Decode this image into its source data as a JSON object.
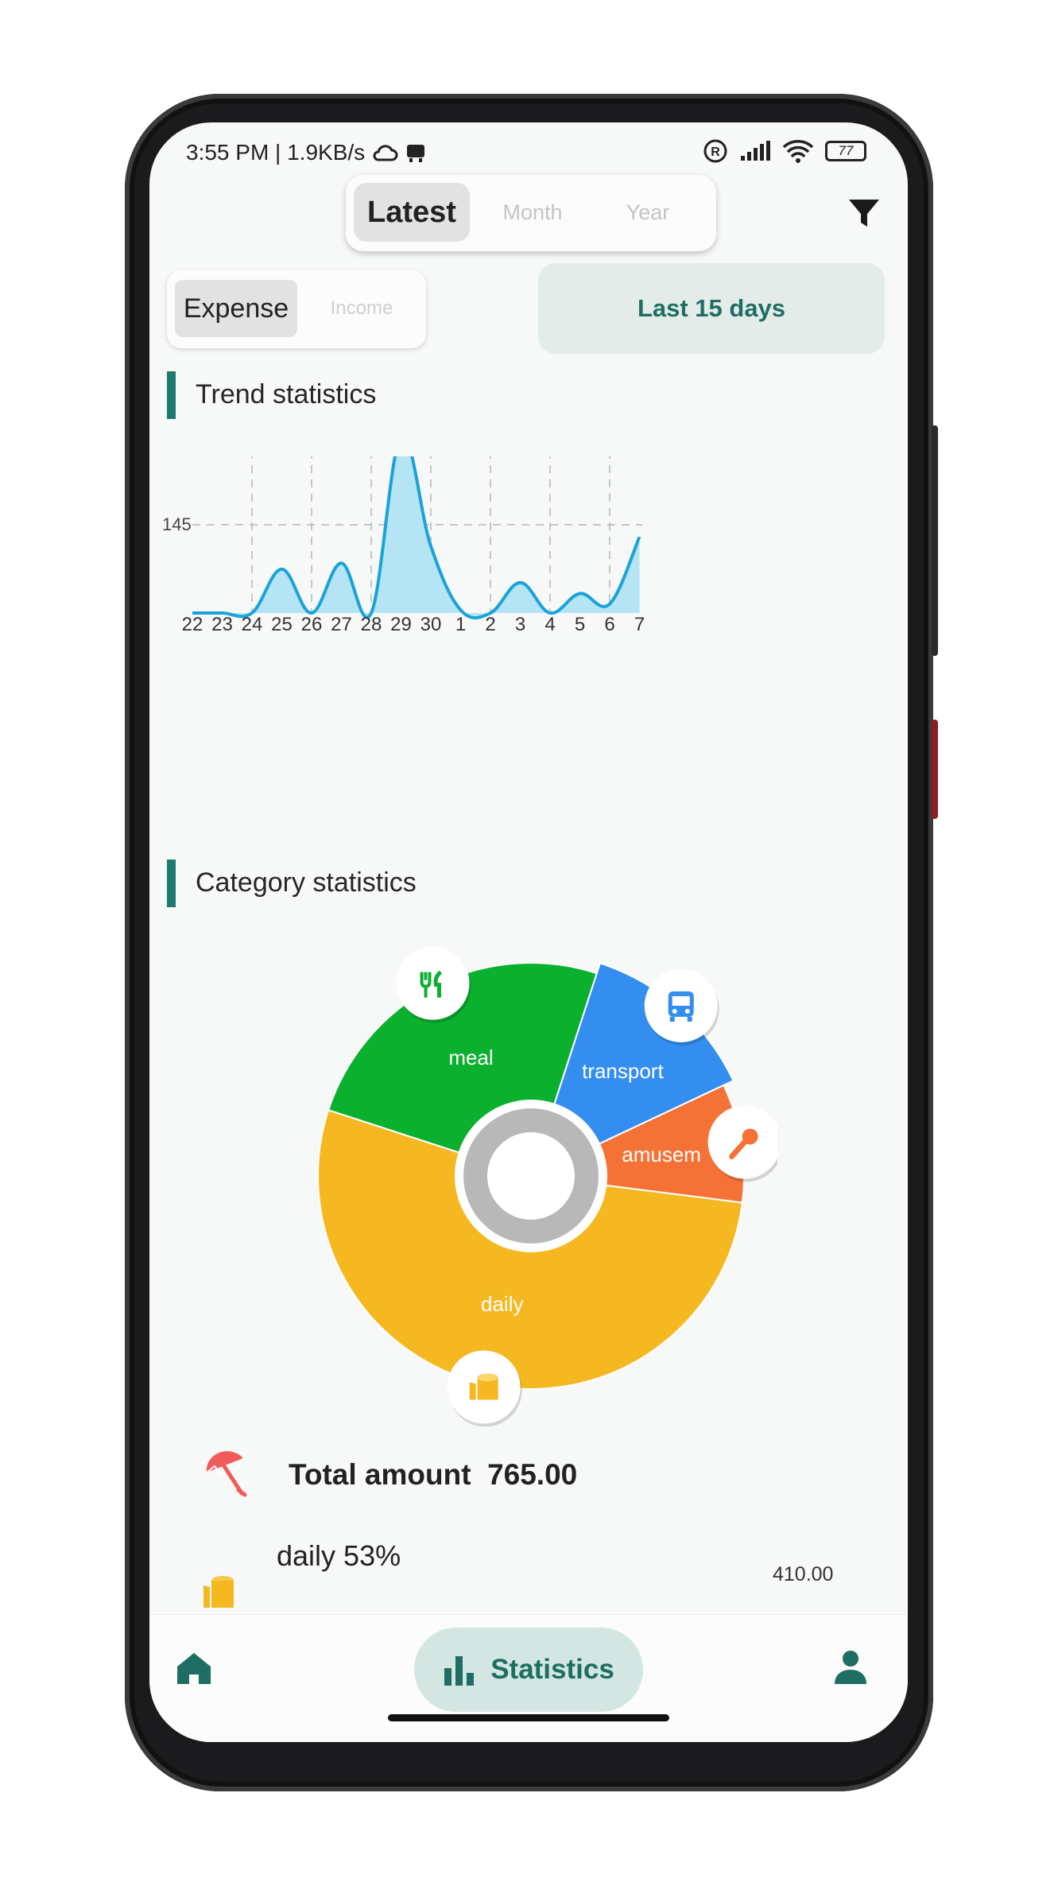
{
  "status_bar": {
    "time_speed": "3:55 PM | 1.9KB/s",
    "battery": "77"
  },
  "period_tabs": [
    {
      "label": "Latest",
      "selected": true
    },
    {
      "label": "Month",
      "selected": false
    },
    {
      "label": "Year",
      "selected": false
    }
  ],
  "type_tabs": [
    {
      "label": "Expense",
      "selected": true
    },
    {
      "label": "Income",
      "selected": false
    }
  ],
  "range_button": "Last 15 days",
  "trend_section": {
    "title": "Trend statistics"
  },
  "category_section": {
    "title": "Category statistics"
  },
  "colors": {
    "accent": "#1e7a6d",
    "line": "#1aa3d9",
    "meal": "#0bb02e",
    "transport": "#348ef0",
    "amusement": "#f57236",
    "daily": "#f5b820"
  },
  "chart_data": [
    {
      "type": "area",
      "title": "Trend statistics",
      "x": [
        "22",
        "23",
        "24",
        "25",
        "26",
        "27",
        "28",
        "29",
        "30",
        "1",
        "2",
        "3",
        "4",
        "5",
        "6",
        "7"
      ],
      "y_ticks": [
        "145",
        "290"
      ],
      "ylim": [
        0,
        290
      ],
      "values": [
        0,
        0,
        0,
        72,
        0,
        82,
        0,
        290,
        110,
        5,
        0,
        50,
        0,
        32,
        15,
        125
      ],
      "grid": "dashed"
    },
    {
      "type": "pie",
      "slices": [
        {
          "label": "meal",
          "icon": "utensils-icon",
          "value": 25
        },
        {
          "label": "transport",
          "icon": "bus-icon",
          "value": 13
        },
        {
          "label": "amusem",
          "icon": "microphone-icon",
          "value": 9
        },
        {
          "label": "daily",
          "icon": "tissue-roll-icon",
          "value": 53
        }
      ]
    }
  ],
  "summary": {
    "label": "Total amount",
    "value": "765.00",
    "icon": "umbrella-icon"
  },
  "category_rows": [
    {
      "name": "daily 53%",
      "amount": "410.00",
      "icon": "tissue-roll-icon"
    }
  ],
  "bottom_nav": {
    "home_icon": "home-icon",
    "statistics_label": "Statistics",
    "profile_icon": "person-icon"
  }
}
